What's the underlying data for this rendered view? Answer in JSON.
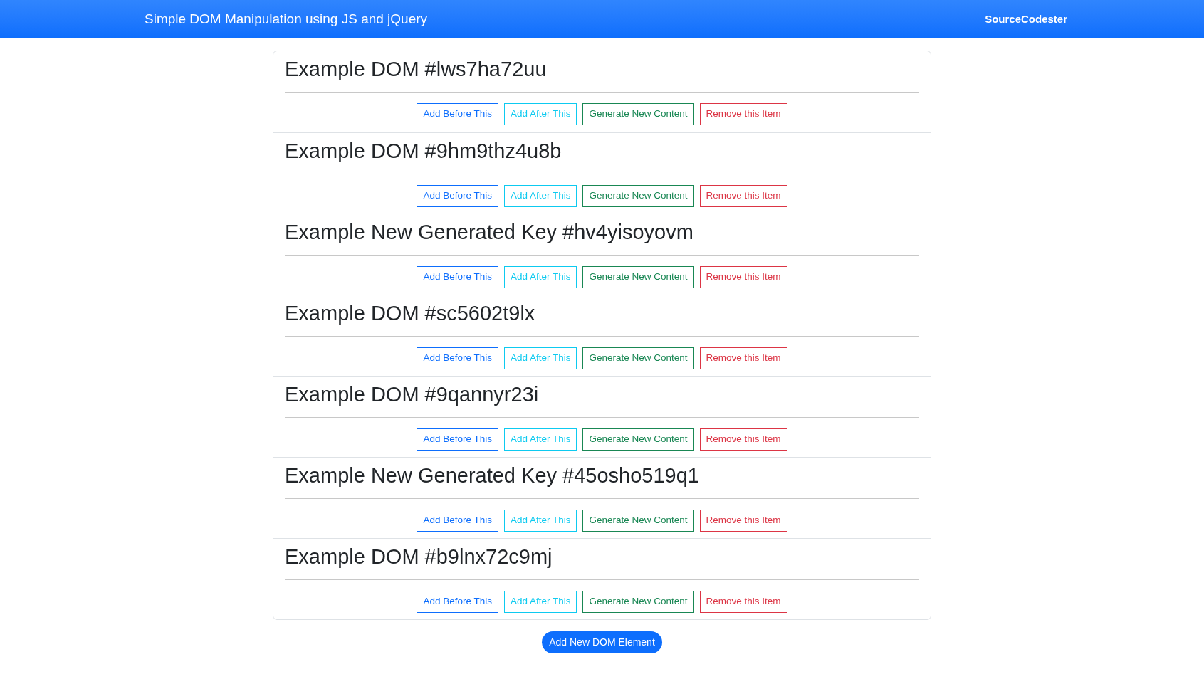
{
  "navbar": {
    "title": "Simple DOM Manipulation using JS and jQuery",
    "brand": "SourceCodester"
  },
  "items": [
    {
      "title": "Example DOM #lws7ha72uu",
      "buttons": [
        {
          "label": "Add Before This",
          "kind": "primary"
        },
        {
          "label": "Add After This",
          "kind": "info"
        },
        {
          "label": "Generate New Content",
          "kind": "success"
        },
        {
          "label": "Remove this Item",
          "kind": "danger"
        }
      ]
    },
    {
      "title": "Example DOM #9hm9thz4u8b",
      "buttons": [
        {
          "label": "Add Before This",
          "kind": "primary"
        },
        {
          "label": "Add After This",
          "kind": "info"
        },
        {
          "label": "Generate New Content",
          "kind": "success"
        },
        {
          "label": "Remove this Item",
          "kind": "danger"
        }
      ]
    },
    {
      "title": "Example New Generated Key #hv4yisoyovm",
      "buttons": [
        {
          "label": "Add Before This",
          "kind": "primary"
        },
        {
          "label": "Add After This",
          "kind": "info"
        },
        {
          "label": "Generate New Content",
          "kind": "success"
        },
        {
          "label": "Remove this Item",
          "kind": "danger"
        }
      ]
    },
    {
      "title": "Example DOM #sc5602t9lx",
      "buttons": [
        {
          "label": "Add Before This",
          "kind": "primary"
        },
        {
          "label": "Add After This",
          "kind": "info"
        },
        {
          "label": "Generate New Content",
          "kind": "success"
        },
        {
          "label": "Remove this Item",
          "kind": "danger"
        }
      ]
    },
    {
      "title": "Example DOM #9qannyr23i",
      "buttons": [
        {
          "label": "Add Before This",
          "kind": "primary"
        },
        {
          "label": "Add After This",
          "kind": "info"
        },
        {
          "label": "Generate New Content",
          "kind": "success"
        },
        {
          "label": "Remove this Item",
          "kind": "danger"
        }
      ]
    },
    {
      "title": "Example New Generated Key #45osho519q1",
      "buttons": [
        {
          "label": "Add Before This",
          "kind": "primary"
        },
        {
          "label": "Add After This",
          "kind": "info"
        },
        {
          "label": "Generate New Content",
          "kind": "success"
        },
        {
          "label": "Remove this Item",
          "kind": "danger"
        }
      ]
    },
    {
      "title": "Example DOM #b9lnx72c9mj",
      "buttons": [
        {
          "label": "Add Before This",
          "kind": "primary"
        },
        {
          "label": "Add After This",
          "kind": "info"
        },
        {
          "label": "Generate New Content",
          "kind": "success"
        },
        {
          "label": "Remove this Item",
          "kind": "danger"
        }
      ]
    }
  ],
  "add_button": "Add New DOM Element"
}
